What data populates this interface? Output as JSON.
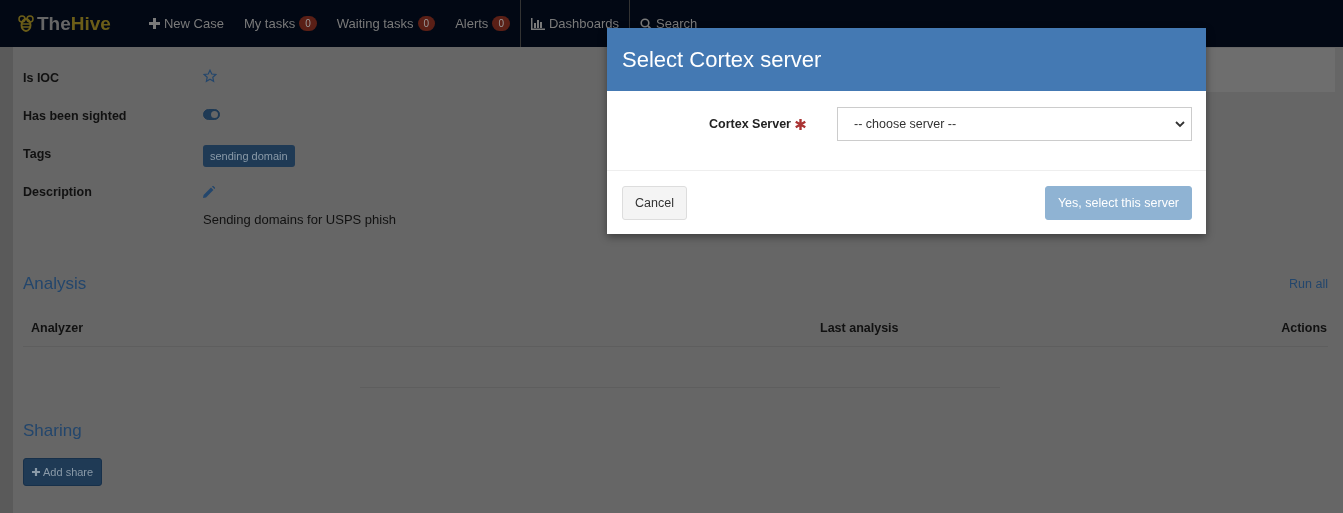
{
  "navbar": {
    "brand": {
      "part1": "The",
      "part2": "Hive"
    },
    "items": [
      {
        "kind": "plus",
        "label": "New Case"
      },
      {
        "kind": "count",
        "label": "My tasks",
        "count": "0"
      },
      {
        "kind": "count",
        "label": "Waiting tasks",
        "count": "0"
      },
      {
        "kind": "count",
        "label": "Alerts",
        "count": "0"
      },
      {
        "kind": "chart",
        "label": "Dashboards"
      },
      {
        "kind": "search",
        "label": "Search"
      }
    ]
  },
  "details": [
    {
      "kind": "ioc",
      "label": "Is IOC",
      "ioc": false
    },
    {
      "kind": "sighted",
      "label": "Has been sighted",
      "on": true
    },
    {
      "kind": "tags",
      "label": "Tags",
      "tags": [
        "sending domain"
      ]
    },
    {
      "kind": "description",
      "label": "Description",
      "text": "Sending domains for USPS phish"
    }
  ],
  "analysis": {
    "title": "Analysis",
    "run_all": "Run all",
    "columns": [
      "Analyzer",
      "Last analysis",
      "Actions"
    ]
  },
  "sharing": {
    "title": "Sharing",
    "button": "Add share"
  },
  "dialog": {
    "title": "Select Cortex server",
    "field_label": "Cortex Server",
    "required": true,
    "select_value": "-- choose server --",
    "cancel": "Cancel",
    "confirm": "Yes, select this server",
    "confirm_disabled": true
  }
}
